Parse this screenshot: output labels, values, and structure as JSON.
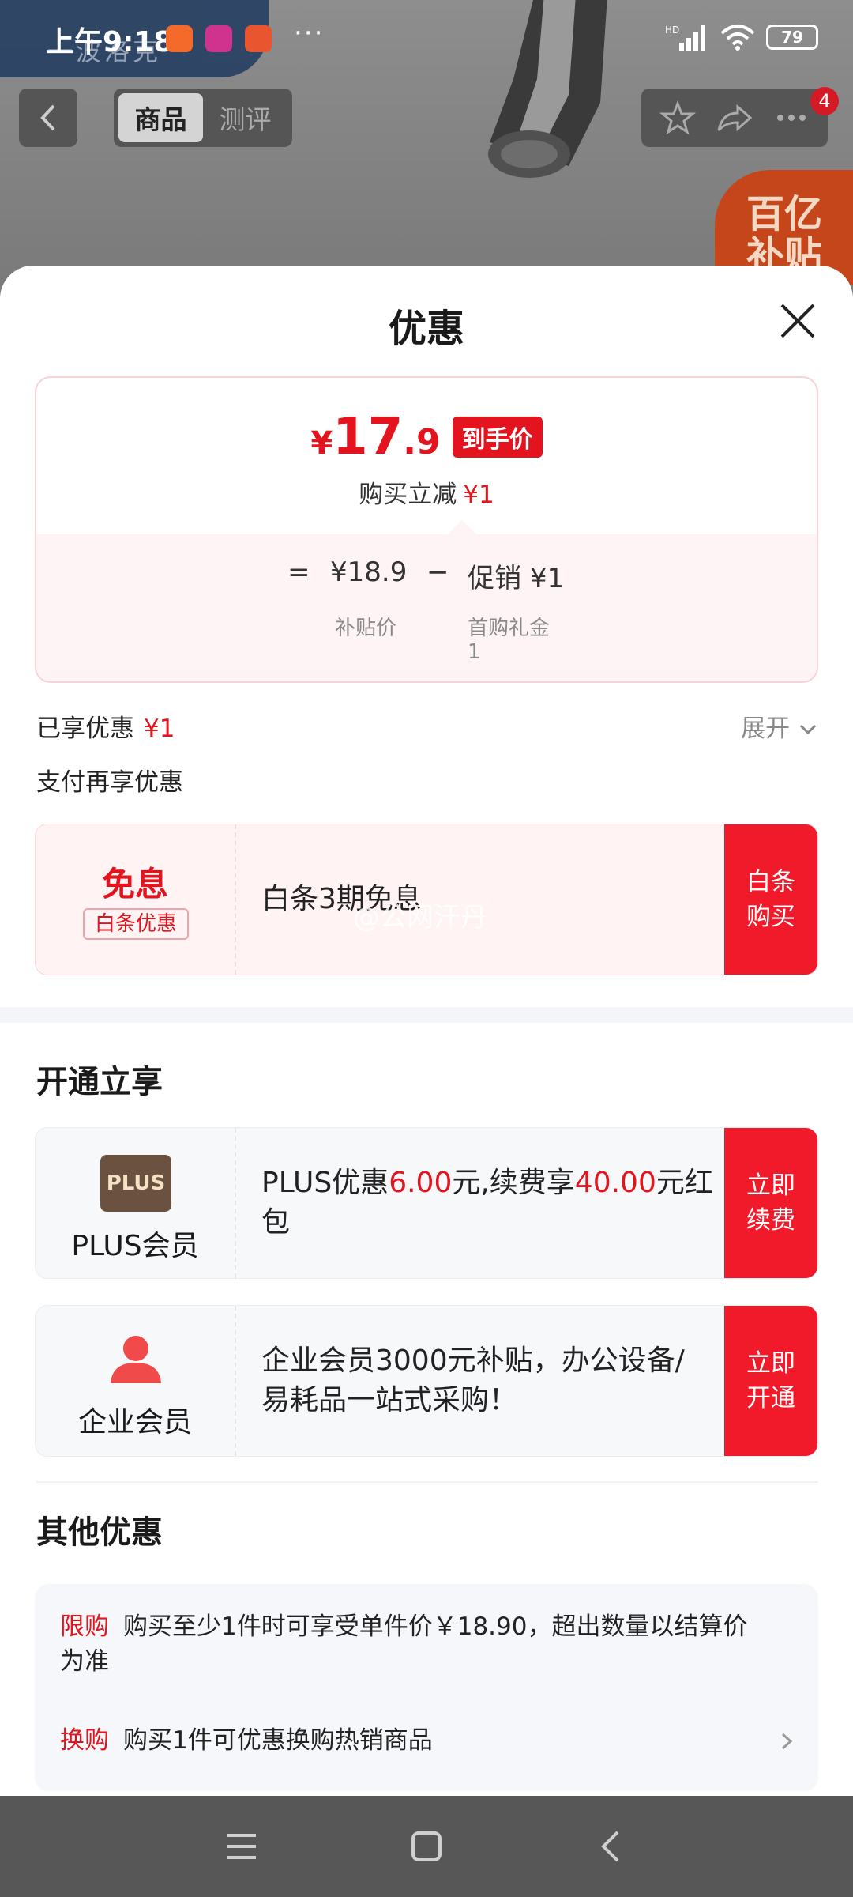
{
  "status_bar": {
    "time": "上午9:18",
    "battery": "79",
    "more": "···",
    "hd": "HD"
  },
  "background": {
    "logo_text": "一波洛克",
    "tabs": [
      {
        "label": "商品"
      },
      {
        "label": "测评"
      }
    ],
    "cart_badge": "4",
    "promo_badge": [
      "百亿",
      "补贴"
    ]
  },
  "sheet": {
    "title": "优惠",
    "price_card": {
      "currency": "¥",
      "price_int": "17",
      "price_dec": ".9",
      "price_tag": "到手价",
      "reduce_label": "购买立减",
      "reduce_value": "¥1",
      "eq": "=",
      "base_price": "¥18.9",
      "minus": "−",
      "promo_label": "促销",
      "promo_value": "¥1",
      "base_label": "补贴价",
      "promo_detail": "首购礼金",
      "promo_detail_2": "1"
    },
    "enjoyed_label": "已享优惠",
    "enjoyed_value": "¥1",
    "expand_label": "展开",
    "pay_more_label": "支付再享优惠",
    "baitiao": {
      "title": "免息",
      "tag": "白条优惠",
      "desc": "白条3期免息",
      "watermark": "@公网汗丹",
      "button": "白条购买"
    },
    "open_section_title": "开通立享",
    "plus": {
      "logo_text": "PLUS",
      "name": "PLUS会员",
      "desc_1": "PLUS优惠",
      "desc_amount_1": "6.00",
      "desc_2": "元,续费享",
      "desc_amount_2": "40.00",
      "desc_3": "元红包",
      "button": "立即续费"
    },
    "enterprise": {
      "name": "企业会员",
      "desc": "企业会员3000元补贴，办公设备/易耗品一站式采购！",
      "button": "立即开通"
    },
    "other_section_title": "其他优惠",
    "other": [
      {
        "tag": "限购",
        "text": "购买至少1件时可享受单件价￥18.90，超出数量以结算价为准"
      },
      {
        "tag": "换购",
        "text": "购买1件可优惠换购热销商品"
      }
    ]
  },
  "colors": {
    "accent": "#e4141e",
    "button_red": "#f01a2a",
    "plus_brown": "#6b5240",
    "enterprise_red": "#f04a4a"
  }
}
